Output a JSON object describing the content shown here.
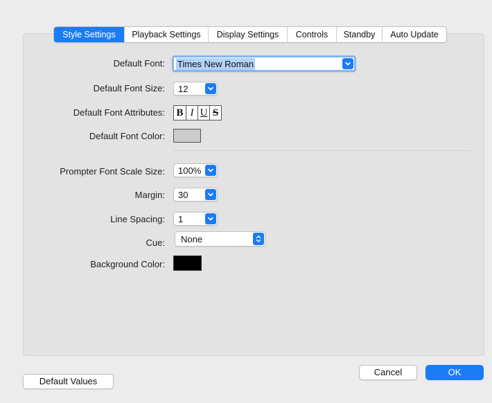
{
  "tabs": [
    {
      "label": "Style Settings",
      "active": true
    },
    {
      "label": "Playback Settings"
    },
    {
      "label": "Display Settings"
    },
    {
      "label": "Controls"
    },
    {
      "label": "Standby"
    },
    {
      "label": "Auto Update"
    }
  ],
  "form": {
    "default_font": {
      "label": "Default Font:",
      "value": "Times New Roman"
    },
    "default_font_size": {
      "label": "Default Font Size:",
      "value": "12"
    },
    "default_font_attributes": {
      "label": "Default Font Attributes:",
      "bold": "B",
      "italic": "I",
      "underline": "U",
      "strikethrough": "S"
    },
    "default_font_color": {
      "label": "Default Font Color:",
      "color": "#cccccc"
    },
    "prompter_font_scale_size": {
      "label": "Prompter Font Scale Size:",
      "value": "100%"
    },
    "margin": {
      "label": "Margin:",
      "value": "30"
    },
    "line_spacing": {
      "label": "Line Spacing:",
      "value": "1"
    },
    "cue": {
      "label": "Cue:",
      "value": "None"
    },
    "background_color": {
      "label": "Background Color:",
      "color": "#000000"
    }
  },
  "buttons": {
    "default_values": "Default Values",
    "cancel": "Cancel",
    "ok": "OK"
  },
  "colors": {
    "accent": "#1b7cf4"
  }
}
